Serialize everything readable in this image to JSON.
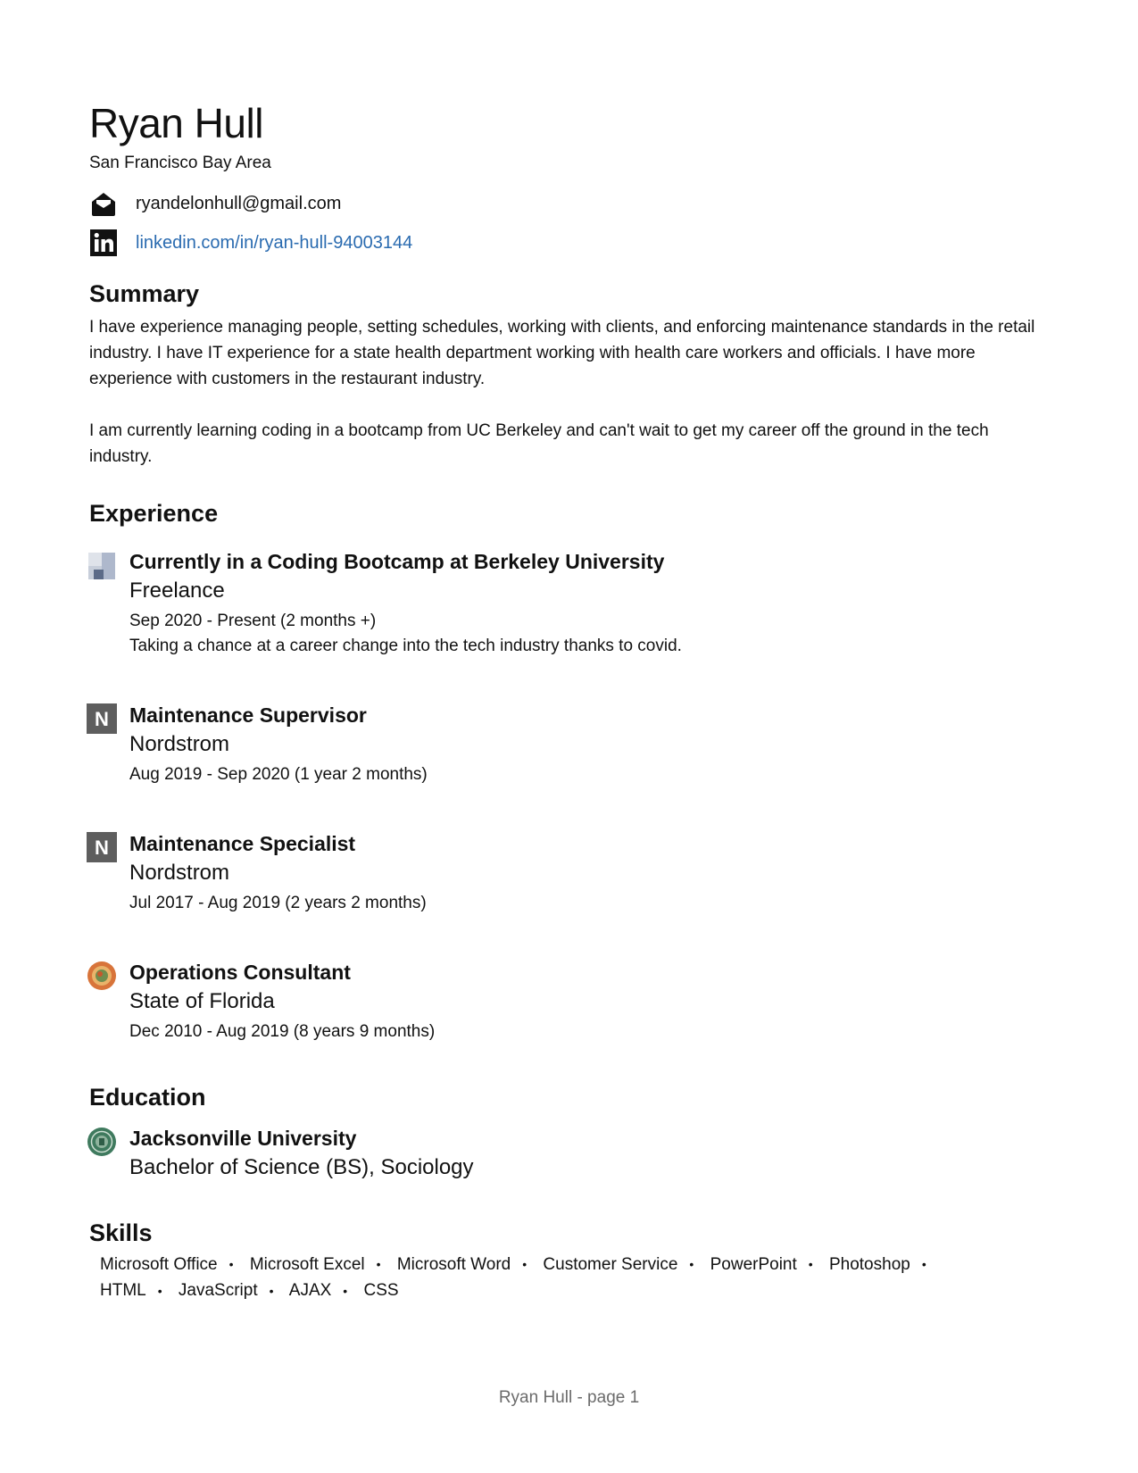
{
  "header": {
    "name": "Ryan Hull",
    "location": "San Francisco Bay Area",
    "email": "ryandelonhull@gmail.com",
    "linkedin": "linkedin.com/in/ryan-hull-94003144",
    "email_icon": "envelope-icon",
    "linkedin_icon": "linkedin-icon"
  },
  "summary": {
    "title": "Summary",
    "paragraphs": [
      "I have experience managing people, setting schedules, working with clients, and enforcing maintenance standards in the retail industry. I have IT experience for a state health department working with health care workers and officials. I have more experience with customers in the restaurant industry.",
      "I am currently learning coding in a bootcamp from UC Berkeley and can't wait to get my career off the ground in the tech industry."
    ]
  },
  "experience": {
    "title": "Experience",
    "items": [
      {
        "title": "Currently in a Coding Bootcamp at Berkeley University",
        "org": "Freelance",
        "dates": "Sep 2020 - Present (2 months +)",
        "description": "Taking a chance at a career change into the tech industry thanks to covid.",
        "logo": "freelance-logo-icon"
      },
      {
        "title": "Maintenance Supervisor",
        "org": "Nordstrom",
        "dates": "Aug 2019 - Sep 2020 (1 year 2 months)",
        "logo": "nordstrom-logo-icon",
        "logo_letter": "N"
      },
      {
        "title": "Maintenance Specialist",
        "org": "Nordstrom",
        "dates": "Jul 2017 - Aug 2019 (2 years 2 months)",
        "logo": "nordstrom-logo-icon",
        "logo_letter": "N"
      },
      {
        "title": "Operations Consultant",
        "org": "State of Florida",
        "dates": "Dec 2010 - Aug 2019 (8 years 9 months)",
        "logo": "florida-seal-icon"
      }
    ]
  },
  "education": {
    "title": "Education",
    "items": [
      {
        "school": "Jacksonville University",
        "degree": "Bachelor of Science (BS), Sociology",
        "logo": "jacksonville-seal-icon"
      }
    ]
  },
  "skills": {
    "title": "Skills",
    "items": [
      "Microsoft Office",
      "Microsoft Excel",
      "Microsoft Word",
      "Customer Service",
      "PowerPoint",
      "Photoshop",
      "HTML",
      "JavaScript",
      "AJAX",
      "CSS"
    ],
    "separator": "•"
  },
  "footer": {
    "text": "Ryan Hull - page 1"
  },
  "colors": {
    "text": "#111111",
    "link": "#2a6bb0",
    "footer": "#6b6b6b",
    "nordstrom_logo_bg": "#5e5e5e",
    "florida_seal": "#d8743a",
    "jacksonville_seal": "#3f7a5e"
  }
}
